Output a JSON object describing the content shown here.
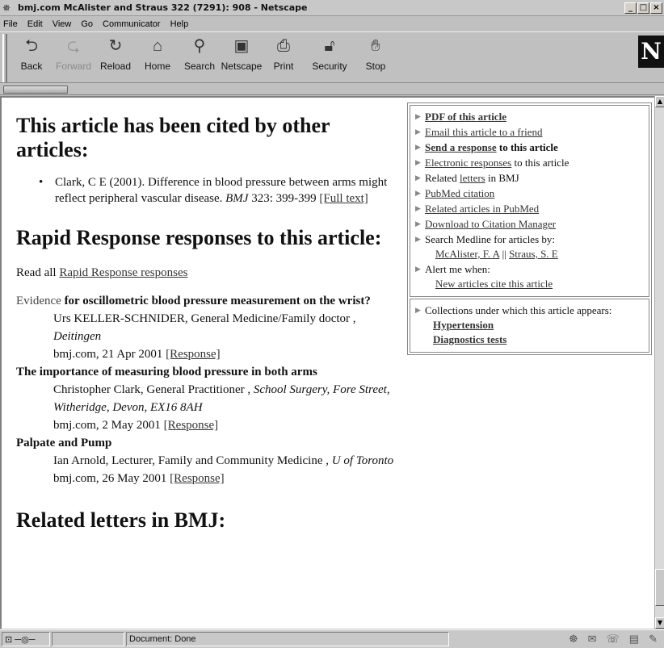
{
  "window": {
    "title": "bmj.com McAlister and Straus 322 (7291): 908 - Netscape",
    "controls": [
      "_",
      "□",
      "×"
    ]
  },
  "menu": {
    "file": "File",
    "edit": "Edit",
    "view": "View",
    "go": "Go",
    "communicator": "Communicator",
    "help": "Help"
  },
  "toolbar": {
    "back": "Back",
    "forward": "Forward",
    "reload": "Reload",
    "home": "Home",
    "search": "Search",
    "netscape": "Netscape",
    "print": "Print",
    "security": "Security",
    "stop": "Stop",
    "logo": "N"
  },
  "main": {
    "cited_heading": "This article has been cited by other articles:",
    "cited_item": {
      "text_a": "Clark, C E (2001). Difference in blood pressure between arms might reflect peripheral vascular disease.",
      "journal": "BMJ",
      "text_b": "323: 399-399",
      "link": "[Full text]"
    },
    "rapid_heading": "Rapid Response responses to this article:",
    "read_all_prefix": "Read all",
    "read_all_link": "Rapid Response responses",
    "responses": [
      {
        "title_a": "Evidence",
        "title_b": "for oscillometric blood pressure measurement on the wrist?",
        "author": "Urs KELLER-SCHNIDER, General Medicine/Family doctor ,",
        "place": "Deitingen",
        "date": "bmj.com, 21 Apr 2001",
        "link": "[Response]"
      },
      {
        "title": "The importance of measuring blood pressure in both arms",
        "author": "Christopher Clark, General Practitioner ,",
        "place": "School Surgery, Fore Street, Witheridge, Devon, EX16 8AH",
        "date": "bmj.com, 2 May 2001",
        "link": "[Response]"
      },
      {
        "title": "Palpate and Pump",
        "author": "Ian Arnold, Lecturer, Family and Community Medicine ,",
        "place": "U of Toronto",
        "date": "bmj.com, 26 May 2001",
        "link": "[Response]"
      }
    ],
    "letters_heading": "Related letters in BMJ:"
  },
  "sidebar": {
    "pdf": "PDF of this article",
    "email": "Email this article to a friend",
    "send_link": "Send a response",
    "send_rest": "to this article",
    "electronic_link": "Electronic responses",
    "electronic_rest": "to this article",
    "related_prefix": "Related",
    "related_link": "letters",
    "related_rest": "in BMJ",
    "pubmed": "PubMed citation",
    "related_pubmed": "Related articles in PubMed",
    "download": "Download to Citation Manager",
    "search_medline": "Search Medline for articles by:",
    "author1": "McAlister, F. A",
    "sep": "||",
    "author2": "Straus, S. E",
    "alert": "Alert me when:",
    "new_cite": "New articles cite this article",
    "collections": "Collections under which this article appears:",
    "coll1": "Hypertension",
    "coll2": "Diagnostics tests"
  },
  "status": {
    "text": "Document: Done"
  }
}
